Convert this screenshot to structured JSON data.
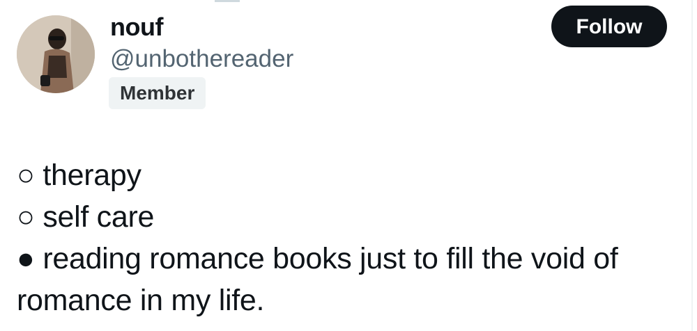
{
  "profile": {
    "display_name": "nouf",
    "handle": "@unbothereader",
    "badge": "Member",
    "avatar_icon": "profile-photo"
  },
  "actions": {
    "follow_label": "Follow"
  },
  "tweet": {
    "lines": [
      "○ therapy",
      "○ self care",
      "● reading romance books just to fill the void of romance in my life."
    ]
  }
}
